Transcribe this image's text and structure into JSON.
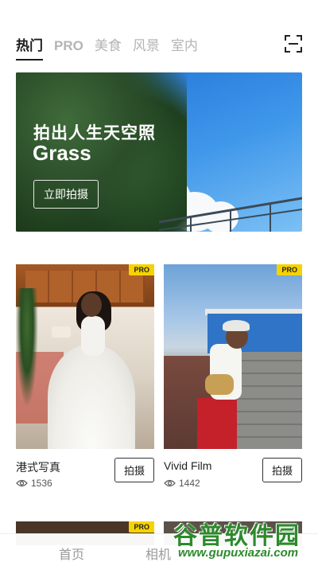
{
  "tabs": [
    {
      "label": "热门",
      "active": true
    },
    {
      "label": "PRO",
      "active": false
    },
    {
      "label": "美食",
      "active": false
    },
    {
      "label": "风景",
      "active": false
    },
    {
      "label": "室内",
      "active": false
    }
  ],
  "scan_icon": "scan-frame-icon",
  "banner": {
    "title": "拍出人生天空照",
    "subtitle": "Grass",
    "button_label": "立即拍摄"
  },
  "cards": [
    {
      "name": "港式写真",
      "views": "1536",
      "badge": "PRO",
      "button_label": "拍摄"
    },
    {
      "name": "Vivid Film",
      "views": "1442",
      "badge": "PRO",
      "button_label": "拍摄"
    }
  ],
  "next_row": {
    "badge": "PRO"
  },
  "bottom_nav": {
    "home_label": "首页",
    "camera_label": "相机"
  },
  "watermark": {
    "main": "谷普软件园",
    "url": "www.gupuxiazai.com"
  },
  "colors": {
    "accent": "#1c1c1c",
    "inactive_tab": "#b4b4b4",
    "pro_badge": "#f6d300"
  }
}
